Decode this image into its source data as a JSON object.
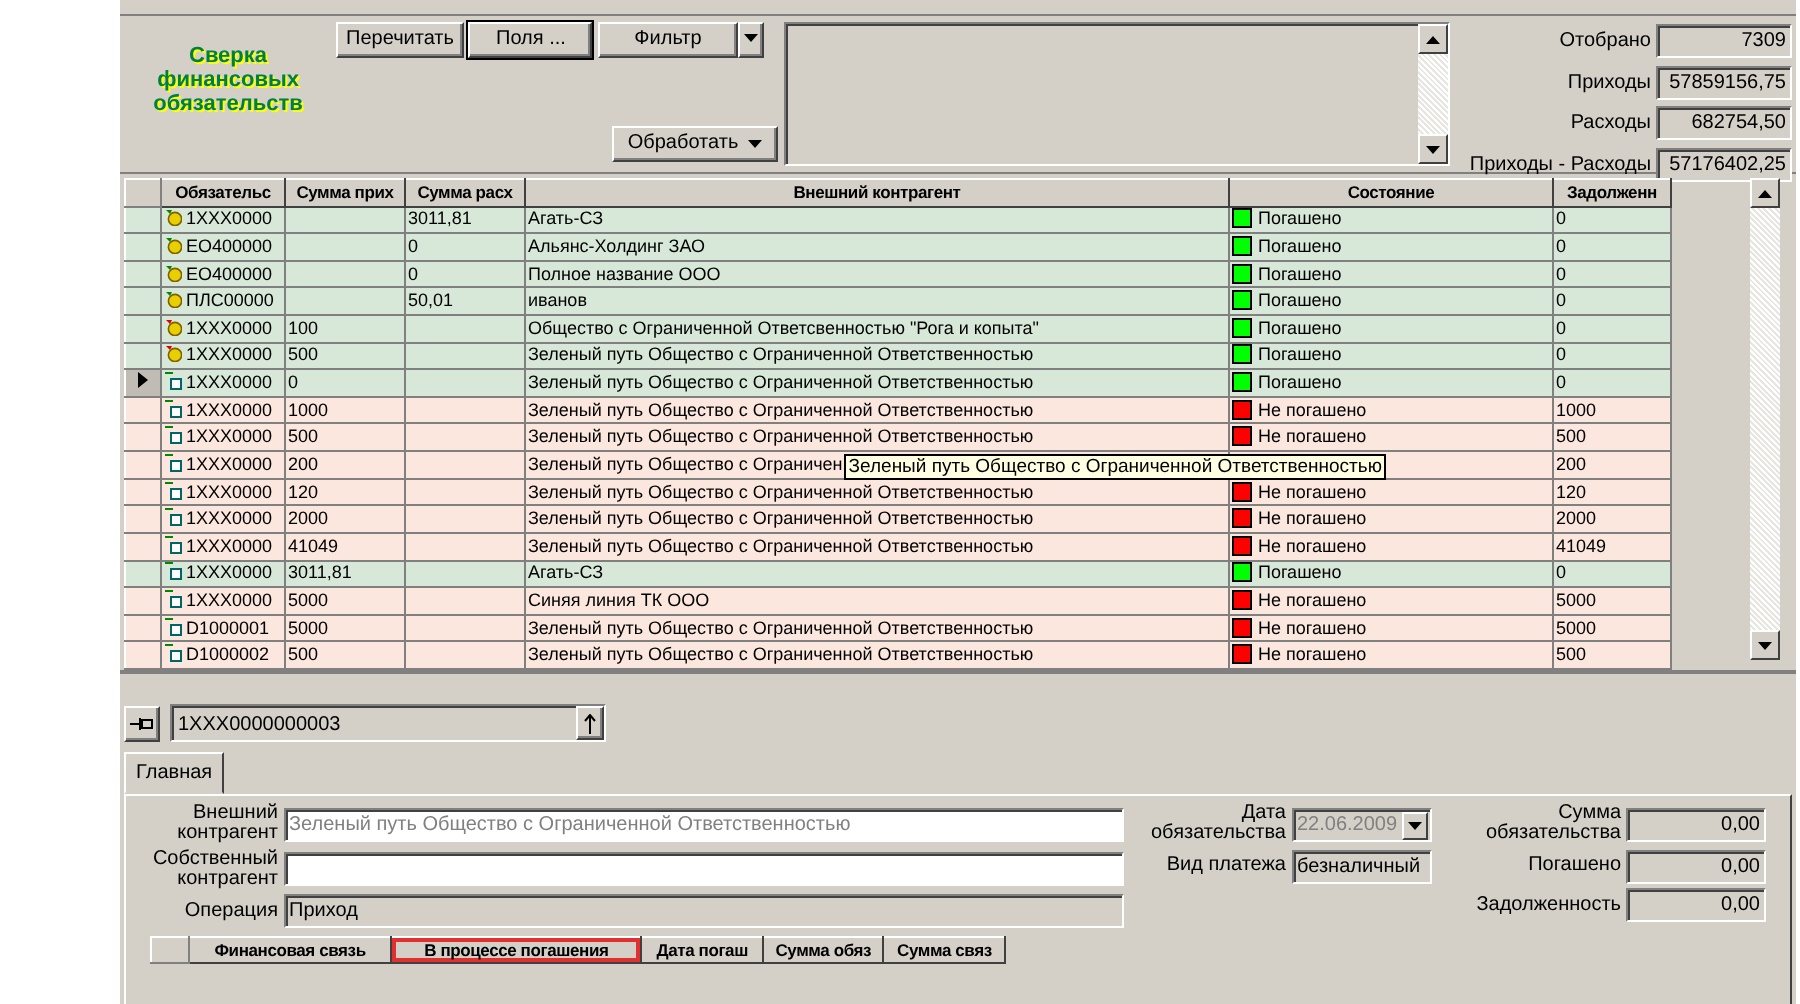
{
  "title": "Сверка финансовых обязательств",
  "toolbar": {
    "buttons": [
      {
        "label": "Перечитать",
        "kind": "plain",
        "pressed": false
      },
      {
        "label": "Поля ...",
        "kind": "plain",
        "pressed": true
      },
      {
        "label": "Фильтр",
        "kind": "split",
        "pressed": false
      }
    ],
    "process_button": {
      "label": "Обработать"
    }
  },
  "stats": [
    {
      "label": "Отобрано",
      "value": "7309"
    },
    {
      "label": "Приходы",
      "value": "57859156,75"
    },
    {
      "label": "Расходы",
      "value": "682754,50"
    },
    {
      "label": "Приходы - Расходы",
      "value": "57176402,25"
    }
  ],
  "table": {
    "columns": [
      "Обязательс",
      "Сумма прих",
      "Сумма расх",
      "Внешний контрагент",
      "Состояние",
      "Задолженн"
    ],
    "rows": [
      {
        "kind": "coin",
        "selected": false,
        "paid": true,
        "cells": [
          "1XXX0000",
          "",
          "3011,81",
          "Агать-СЗ",
          "Погашено",
          "0"
        ]
      },
      {
        "kind": "coin",
        "selected": false,
        "paid": true,
        "cells": [
          "ЕО400000",
          "",
          "0",
          "Альянс-Холдинг ЗАО",
          "Погашено",
          "0"
        ]
      },
      {
        "kind": "coin",
        "selected": false,
        "paid": true,
        "cells": [
          "ЕО400000",
          "",
          "0",
          "Полное название ООО",
          "Погашено",
          "0"
        ]
      },
      {
        "kind": "coin",
        "selected": false,
        "paid": true,
        "cells": [
          "ПЛС00000",
          "",
          "50,01",
          "иванов",
          "Погашено",
          "0"
        ]
      },
      {
        "kind": "coin-red",
        "selected": false,
        "paid": true,
        "cells": [
          "1XXX0000",
          "100",
          "",
          "Общество с Ограниченной Ответсвенностью \"Рога и копыта\"",
          "Погашено",
          "0"
        ]
      },
      {
        "kind": "coin-red",
        "selected": false,
        "paid": true,
        "cells": [
          "1XXX0000",
          "500",
          "",
          "Зеленый путь Общество с Ограниченной Ответственностью",
          "Погашено",
          "0"
        ]
      },
      {
        "kind": "doc",
        "selected": true,
        "paid": true,
        "cells": [
          "1XXX0000",
          "0",
          "",
          "Зеленый путь Общество с Ограниченной Ответственностью",
          "Погашено",
          "0"
        ]
      },
      {
        "kind": "doc",
        "selected": false,
        "paid": false,
        "cells": [
          "1XXX0000",
          "1000",
          "",
          "Зеленый путь Общество с Ограниченной Ответственностью",
          "Не погашено",
          "1000"
        ]
      },
      {
        "kind": "doc",
        "selected": false,
        "paid": false,
        "cells": [
          "1XXX0000",
          "500",
          "",
          "Зеленый путь Общество с Ограниченной Ответственностью",
          "Не погашено",
          "500"
        ]
      },
      {
        "kind": "doc",
        "selected": false,
        "paid": false,
        "cells": [
          "1XXX0000",
          "200",
          "",
          "Зеленый путь Общество с Ограничен",
          "",
          "200"
        ],
        "tooltip": "Зеленый путь Общество с Ограниченной Ответственностью"
      },
      {
        "kind": "doc",
        "selected": false,
        "paid": false,
        "cells": [
          "1XXX0000",
          "120",
          "",
          "Зеленый путь Общество с Ограниченной Ответственностью",
          "Не погашено",
          "120"
        ]
      },
      {
        "kind": "doc",
        "selected": false,
        "paid": false,
        "cells": [
          "1XXX0000",
          "2000",
          "",
          "Зеленый путь Общество с Ограниченной Ответственностью",
          "Не погашено",
          "2000"
        ]
      },
      {
        "kind": "doc",
        "selected": false,
        "paid": false,
        "cells": [
          "1XXX0000",
          "41049",
          "",
          "Зеленый путь Общество с Ограниченной Ответственностью",
          "Не погашено",
          "41049"
        ]
      },
      {
        "kind": "doc",
        "selected": false,
        "paid": true,
        "cells": [
          "1XXX0000",
          "3011,81",
          "",
          "Агать-СЗ",
          "Погашено",
          "0"
        ]
      },
      {
        "kind": "doc",
        "selected": false,
        "paid": false,
        "cells": [
          "1XXX0000",
          "5000",
          "",
          "Синяя линия ТК ООО",
          "Не погашено",
          "5000"
        ]
      },
      {
        "kind": "doc",
        "selected": false,
        "paid": false,
        "cells": [
          "D1000001",
          "5000",
          "",
          "Зеленый путь Общество с Ограниченной Ответственностью",
          "Не погашено",
          "5000"
        ]
      },
      {
        "kind": "doc",
        "selected": false,
        "paid": false,
        "cells": [
          "D1000002",
          "500",
          "",
          "Зеленый путь Общество с Ограниченной Ответственностью",
          "Не погашено",
          "500"
        ]
      }
    ]
  },
  "record": {
    "code": "1ХХХ0000000003"
  },
  "tabs": [
    {
      "label": "Главная",
      "selected": true
    }
  ],
  "form": {
    "left": [
      {
        "label": "Внешний контрагент",
        "value": "Зеленый путь Общество с Ограниченной Ответственностью",
        "readonly": true,
        "grey_text": true
      },
      {
        "label": "Собственный контрагент",
        "readonly": false
      },
      {
        "label": "Операция",
        "value": "Приход",
        "readonly": true
      }
    ],
    "middle": [
      {
        "label": "Дата обязательства",
        "value": "22.06.2009",
        "kind": "date",
        "disabled": true
      },
      {
        "label": "Вид платежа",
        "value": "безналичный",
        "kind": "text",
        "disabled": false
      }
    ],
    "right": [
      {
        "label": "Сумма обязательства",
        "value": "0,00"
      },
      {
        "label": "Погашено",
        "value": "0,00"
      },
      {
        "label": "Задолженность",
        "value": "0,00"
      }
    ]
  },
  "links_table": {
    "columns": [
      {
        "label": "Финансовая связь",
        "highlighted": false
      },
      {
        "label": "В процессе погашения",
        "highlighted": true
      },
      {
        "label": "Дата погаш",
        "highlighted": false
      },
      {
        "label": "Сумма обяз",
        "highlighted": false
      },
      {
        "label": "Сумма связ",
        "highlighted": false
      }
    ]
  }
}
